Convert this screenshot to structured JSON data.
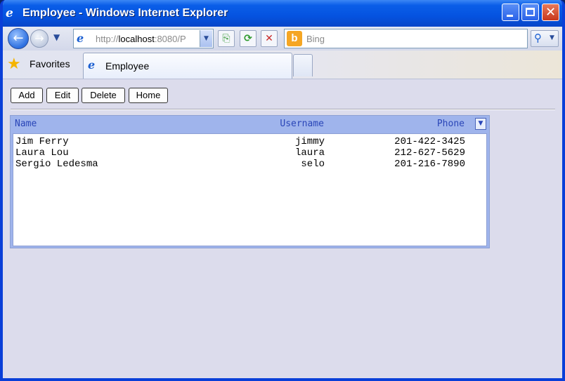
{
  "window": {
    "title": "Employee - Windows Internet Explorer",
    "title_icon": "ie-icon",
    "controls": {
      "minimize": "minimize-button",
      "maximize": "maximize-button",
      "close": "close-button"
    }
  },
  "navbar": {
    "back_icon": "←",
    "forward_icon": "→",
    "address_host": "localhost",
    "address_prefix": "http://",
    "address_suffix": ":8080/P",
    "search_placeholder": "Bing",
    "bing_letter": "b"
  },
  "tabs": {
    "favorites_label": "Favorites",
    "active_tab_label": "Employee"
  },
  "toolbar": {
    "add_label": "Add",
    "edit_label": "Edit",
    "delete_label": "Delete",
    "home_label": "Home"
  },
  "grid": {
    "columns": {
      "name": "Name",
      "username": "Username",
      "phone": "Phone"
    },
    "rows": [
      {
        "name": "Jim Ferry",
        "username": "jimmy",
        "phone": "201-422-3425"
      },
      {
        "name": "Laura Lou",
        "username": "laura",
        "phone": "212-627-5629"
      },
      {
        "name": "Sergio Ledesma",
        "username": "selo",
        "phone": "201-216-7890"
      }
    ]
  },
  "colors": {
    "titlebar": "#0553e0",
    "grid_header": "#9fb4ec",
    "header_text": "#2a46b8",
    "page_bg": "#dcdcec"
  }
}
